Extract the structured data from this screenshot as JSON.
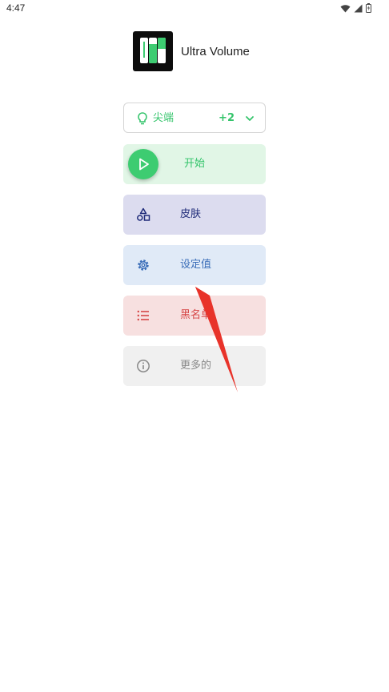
{
  "status_bar": {
    "time": "4:47",
    "icons": [
      "wifi-icon",
      "signal-icon",
      "battery-icon"
    ]
  },
  "app": {
    "title": "Ultra Volume",
    "logo": "ultra-volume-logo"
  },
  "profile_selector": {
    "label": "尖端",
    "extra_count": "+2",
    "icon": "lightbulb-icon"
  },
  "menu": {
    "start": {
      "label": "开始",
      "icon": "play-icon"
    },
    "skin": {
      "label": "皮肤",
      "icon": "shapes-icon"
    },
    "settings": {
      "label": "设定值",
      "icon": "gear-icon"
    },
    "blacklist": {
      "label": "黑名单",
      "icon": "list-icon"
    },
    "more": {
      "label": "更多的",
      "icon": "info-icon"
    }
  },
  "colors": {
    "accent_green": "#3dcc71",
    "skin_text": "#1e2a78",
    "settings_text": "#3a6db8",
    "blacklist_text": "#d64545",
    "annotation_arrow": "#e8332a"
  }
}
